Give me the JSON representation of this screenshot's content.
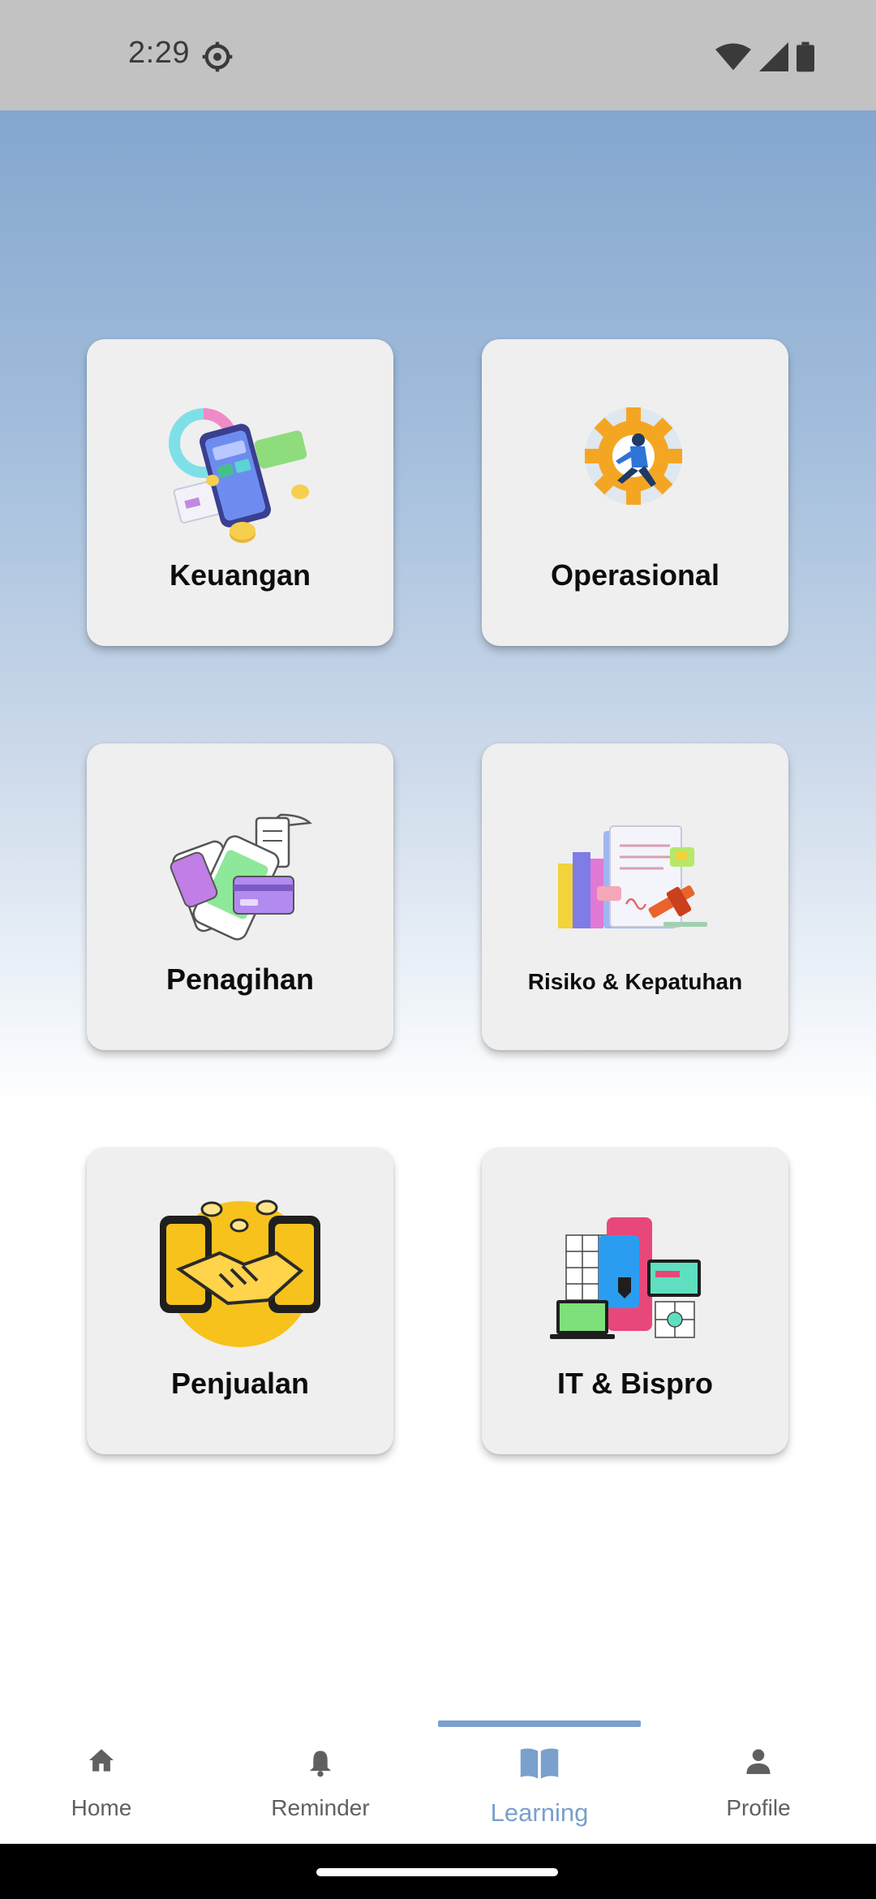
{
  "status_bar": {
    "time": "2:29"
  },
  "categories": [
    {
      "label": "Keuangan",
      "icon": "finance-illustration"
    },
    {
      "label": "Operasional",
      "icon": "operations-gear-illustration"
    },
    {
      "label": "Penagihan",
      "icon": "billing-illustration"
    },
    {
      "label": "Risiko & Kepatuhan",
      "icon": "compliance-illustration"
    },
    {
      "label": "Penjualan",
      "icon": "handshake-illustration"
    },
    {
      "label": "IT & Bispro",
      "icon": "it-devices-illustration"
    }
  ],
  "bottom_nav": {
    "items": [
      {
        "label": "Home",
        "icon": "home-icon"
      },
      {
        "label": "Reminder",
        "icon": "bell-icon"
      },
      {
        "label": "Learning",
        "icon": "book-icon"
      },
      {
        "label": "Profile",
        "icon": "person-icon"
      }
    ],
    "active": "Learning"
  },
  "colors": {
    "accent": "#7aa0cd",
    "card_bg": "#efefef",
    "status_bar_bg": "#c2c2c2",
    "gradient_top": "#84a6cf"
  }
}
